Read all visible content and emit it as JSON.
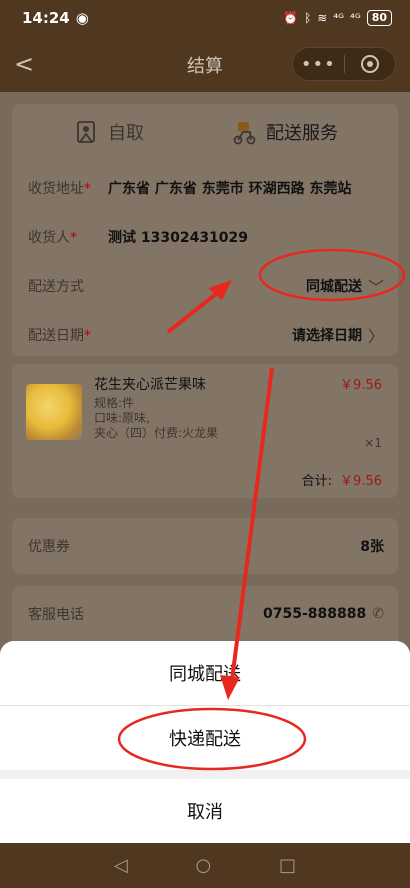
{
  "status": {
    "time": "14:24",
    "eye": "◉",
    "signal1": "⁴ᴳ",
    "signal2": "⁴ᴳ",
    "battery": "80"
  },
  "nav": {
    "back": "<",
    "title": "结算",
    "more": "•••"
  },
  "delivery_mode": {
    "pickup": "自取",
    "delivery": "配送服务"
  },
  "form": {
    "address_label": "收货地址",
    "address_value": "广东省 广东省 东莞市 环湖西路 东莞站",
    "receiver_label": "收货人",
    "receiver_value": "测试 13302431029",
    "method_label": "配送方式",
    "method_value": "同城配送",
    "date_label": "配送日期",
    "date_value": "请选择日期",
    "required_mark": "*"
  },
  "product": {
    "name": "花生夹心派芒果味",
    "price": "￥9.56",
    "spec": "规格:件",
    "flavor": "口味:原味,",
    "filling": "夹心（四）付费:火龙果",
    "qty": "×1",
    "total_label": "合计:",
    "total_value": "￥9.56"
  },
  "coupon": {
    "label": "优惠券",
    "value": "8张"
  },
  "service": {
    "label": "客服电话",
    "value": "0755-888888"
  },
  "sheet": {
    "option1": "同城配送",
    "option2": "快递配送",
    "cancel": "取消"
  },
  "colors": {
    "annotation": "#e8281e",
    "price": "#a01818",
    "brand_bar": "#4f3720"
  }
}
